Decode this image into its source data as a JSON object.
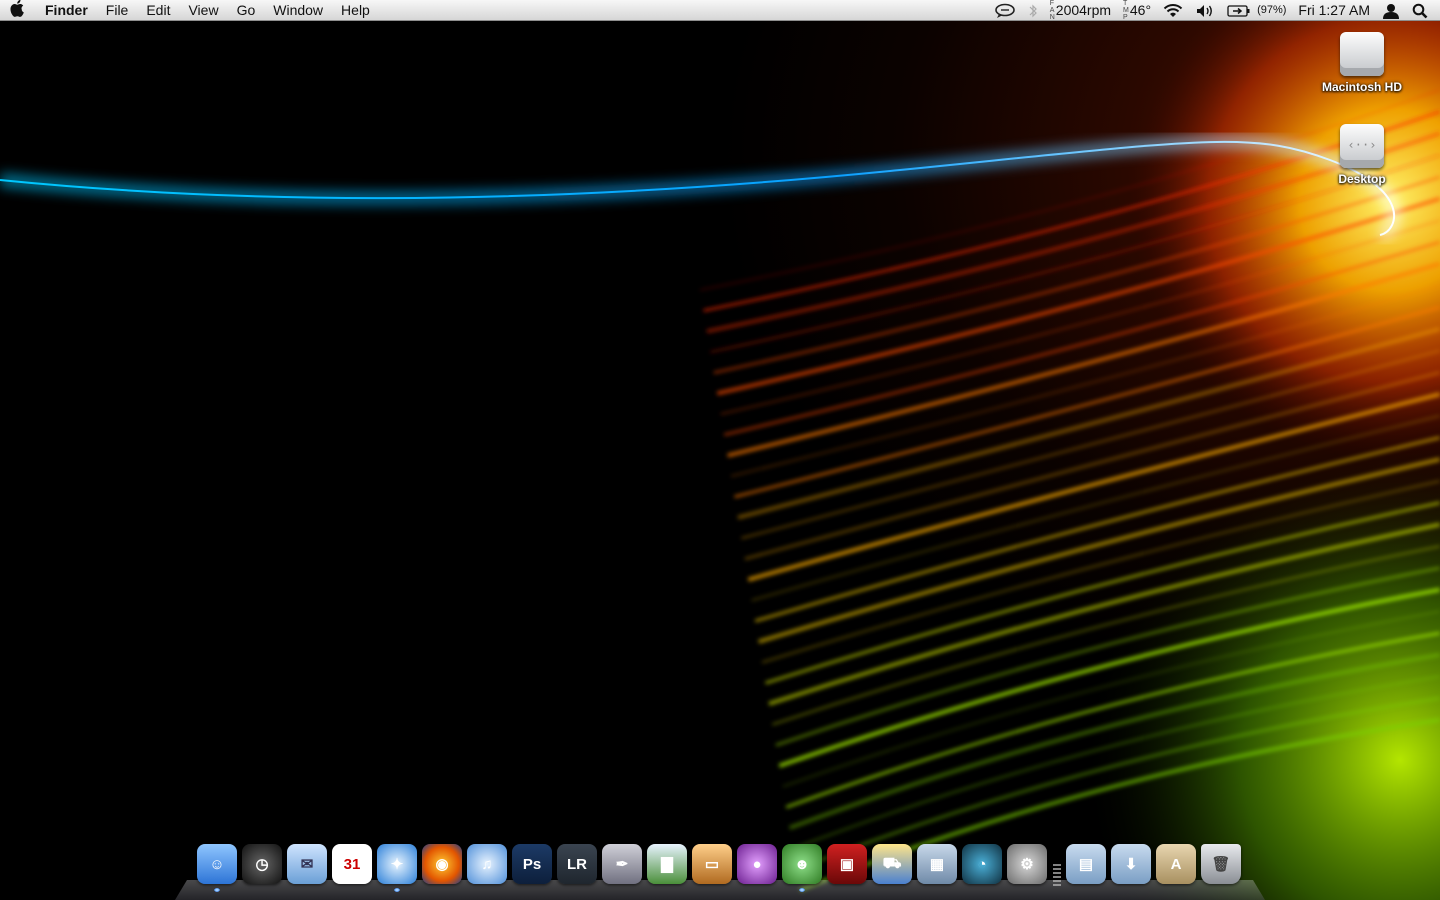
{
  "menubar": {
    "apple": "",
    "app_name": "Finder",
    "items": [
      "File",
      "Edit",
      "View",
      "Go",
      "Window",
      "Help"
    ],
    "status": {
      "fan_letters": [
        "F",
        "A",
        "N"
      ],
      "fan_speed": "2004rpm",
      "temp_letters": [
        "T",
        "M",
        "P"
      ],
      "temperature": "46°",
      "battery_percent": "(97%)",
      "clock": "Fri 1:27 AM"
    }
  },
  "desktop_icons": [
    {
      "label": "Macintosh HD",
      "icon": "hard-drive-icon"
    },
    {
      "label": "Desktop",
      "icon": "network-volume-icon"
    }
  ],
  "dock": {
    "apps": [
      {
        "name": "finder",
        "icon": "finder-icon",
        "glyph": "☺",
        "running": true
      },
      {
        "name": "dashboard",
        "icon": "dashboard-icon",
        "glyph": "◷",
        "running": false
      },
      {
        "name": "mail",
        "icon": "mail-stamp-icon",
        "glyph": "✉",
        "running": false
      },
      {
        "name": "ical",
        "icon": "calendar-icon",
        "glyph": "31",
        "running": false
      },
      {
        "name": "safari",
        "icon": "safari-compass-icon",
        "glyph": "✦",
        "running": true
      },
      {
        "name": "firefox",
        "icon": "firefox-icon",
        "glyph": "◉",
        "running": false
      },
      {
        "name": "itunes",
        "icon": "itunes-icon",
        "glyph": "♫",
        "running": false
      },
      {
        "name": "photoshop",
        "icon": "photoshop-icon",
        "glyph": "Ps",
        "running": false
      },
      {
        "name": "lightroom",
        "icon": "lightroom-icon",
        "glyph": "LR",
        "running": false
      },
      {
        "name": "pen-tool",
        "icon": "pen-nib-icon",
        "glyph": "✒",
        "running": false
      },
      {
        "name": "numbers",
        "icon": "bar-chart-icon",
        "glyph": "▇",
        "running": false
      },
      {
        "name": "keynote",
        "icon": "podium-icon",
        "glyph": "▭",
        "running": false
      },
      {
        "name": "purple-globe",
        "icon": "globe-icon",
        "glyph": "●",
        "running": false
      },
      {
        "name": "adium",
        "icon": "adium-duck-icon",
        "glyph": "☻",
        "running": true
      },
      {
        "name": "photo-booth",
        "icon": "photo-booth-icon",
        "glyph": "▣",
        "running": false
      },
      {
        "name": "transmit",
        "icon": "delivery-truck-icon",
        "glyph": "⛟",
        "running": false
      },
      {
        "name": "spaces",
        "icon": "spaces-grid-icon",
        "glyph": "▦",
        "running": false
      },
      {
        "name": "time-machine",
        "icon": "time-machine-icon",
        "glyph": "◔",
        "running": false
      },
      {
        "name": "system-preferences",
        "icon": "gear-icon",
        "glyph": "⚙",
        "running": false
      }
    ],
    "stacks": [
      {
        "name": "documents",
        "icon": "documents-folder-icon",
        "glyph": "▤"
      },
      {
        "name": "downloads",
        "icon": "downloads-folder-icon",
        "glyph": "⬇"
      },
      {
        "name": "applications",
        "icon": "applications-folder-icon",
        "glyph": "A"
      },
      {
        "name": "trash",
        "icon": "trash-icon",
        "glyph": "🗑"
      }
    ]
  }
}
